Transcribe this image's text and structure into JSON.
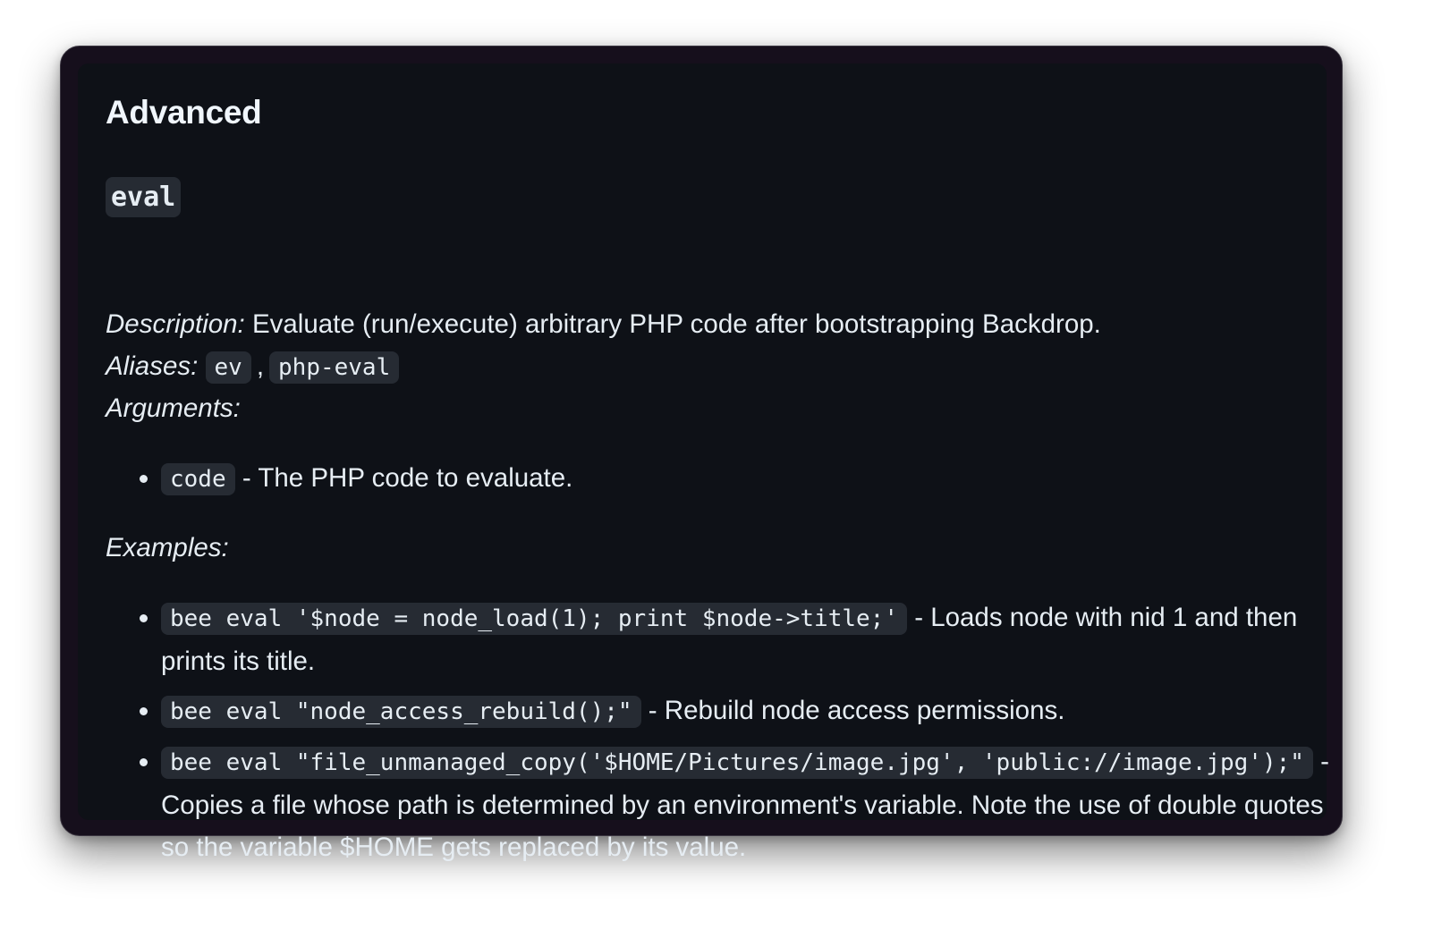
{
  "section": {
    "title": "Advanced"
  },
  "command": {
    "name": "eval",
    "description_label": "Description:",
    "description": "Evaluate (run/execute) arbitrary PHP code after bootstrapping Backdrop.",
    "aliases_label": "Aliases:",
    "aliases": [
      "ev",
      "php-eval"
    ],
    "alias_separator": ",",
    "arguments_label": "Arguments:",
    "arguments": [
      {
        "code": "code",
        "text": "- The PHP code to evaluate."
      }
    ],
    "examples_label": "Examples:",
    "examples": [
      {
        "code": "bee eval '$node = node_load(1); print $node->title;'",
        "text": "- Loads node with nid 1 and then prints its title."
      },
      {
        "code": "bee eval \"node_access_rebuild();\"",
        "text": "- Rebuild node access permissions."
      },
      {
        "code": "bee eval \"file_unmanaged_copy('$HOME/Pictures/image.jpg', 'public://image.jpg');\"",
        "text": "- Copies a file whose path is determined by an environment's variable. Note the use of double quotes so the variable $HOME gets replaced by its value."
      }
    ]
  }
}
